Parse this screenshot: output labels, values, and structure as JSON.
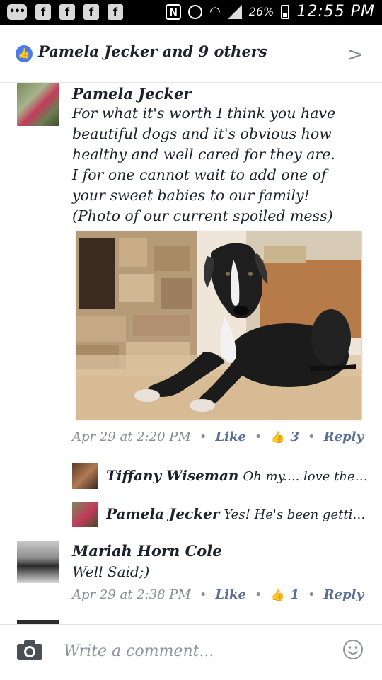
{
  "status_bar": {
    "notif_icons": [
      "messenger-icon",
      "facebook-icon",
      "facebook-icon",
      "facebook-icon",
      "facebook-icon"
    ],
    "battery": "26%",
    "time": "12:55 PM"
  },
  "header": {
    "title": "Pamela Jecker and 9 others"
  },
  "comments": [
    {
      "author": "Pamela Jecker",
      "lines": [
        "For what it's worth I think you have",
        "beautiful dogs and it's obvious how",
        "healthy and well cared for they are.",
        "I for one cannot wait to add one of",
        "your sweet babies to our family!",
        "(Photo of our current spoiled mess)"
      ],
      "time": "Apr 29 at 2:20 PM",
      "like_label": "Like",
      "like_count": "3",
      "reply_label": "Reply",
      "replies": [
        {
          "author": "Tiffany Wiseman",
          "text": "Oh my.... love the s..."
        },
        {
          "author": "Pamela Jecker",
          "text": "Yes! He's been getting..."
        }
      ]
    },
    {
      "author": "Mariah Horn Cole",
      "text": "Well Said;)",
      "time": "Apr 29 at 2:38 PM",
      "like_label": "Like",
      "like_count": "1",
      "reply_label": "Reply"
    }
  ],
  "composer": {
    "placeholder": "Write a comment..."
  },
  "colors": {
    "accent": "#4a7ce8",
    "link": "#5a6e96",
    "meta": "#8a8d91"
  }
}
